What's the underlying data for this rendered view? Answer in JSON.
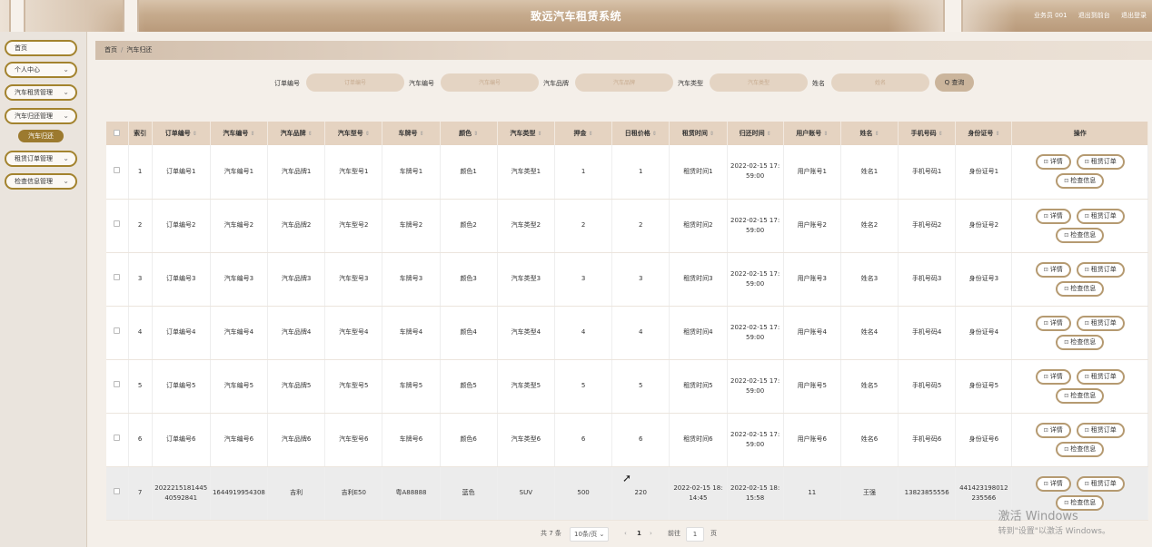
{
  "header": {
    "title": "致远汽车租赁系统",
    "user": "业务员 001",
    "back_label": "退出到前台",
    "logout_label": "退出登录"
  },
  "sidebar": {
    "items": [
      {
        "label": "首页",
        "has_arrow": false
      },
      {
        "label": "个人中心",
        "has_arrow": true
      },
      {
        "label": "汽车租赁管理",
        "has_arrow": true
      },
      {
        "label": "汽车归还管理",
        "has_arrow": true
      },
      {
        "label": "租赁订单管理",
        "has_arrow": true
      },
      {
        "label": "检查信息管理",
        "has_arrow": true
      }
    ],
    "active_sub": "汽车归还",
    "arrow_glyph": "⌄"
  },
  "breadcrumb": {
    "home": "首页",
    "sep": "/",
    "current": "汽车归还"
  },
  "search": {
    "fields": [
      {
        "label": "订单编号",
        "placeholder": "订单编号"
      },
      {
        "label": "汽车编号",
        "placeholder": "汽车编号"
      },
      {
        "label": "汽车品牌",
        "placeholder": "汽车品牌"
      },
      {
        "label": "汽车类型",
        "placeholder": "汽车类型"
      },
      {
        "label": "姓名",
        "placeholder": "姓名"
      }
    ],
    "button_icon": "Q",
    "button_label": "查询"
  },
  "table": {
    "sort_glyph": "⇕",
    "columns": [
      "索引",
      "订单编号",
      "汽车编号",
      "汽车品牌",
      "汽车型号",
      "车牌号",
      "颜色",
      "汽车类型",
      "押金",
      "日租价格",
      "租赁时间",
      "归还时间",
      "用户账号",
      "姓名",
      "手机号码",
      "身份证号",
      "操作"
    ],
    "rows": [
      {
        "idx": "1",
        "order": "订单编号1",
        "car": "汽车编号1",
        "brand": "汽车品牌1",
        "model": "汽车型号1",
        "plate": "车牌号1",
        "color": "颜色1",
        "type": "汽车类型1",
        "deposit": "1",
        "price": "1",
        "rent_time": "租赁时间1",
        "return_time": "2022-02-15 17:59:00",
        "account": "用户账号1",
        "name": "姓名1",
        "phone": "手机号码1",
        "id_no": "身份证号1"
      },
      {
        "idx": "2",
        "order": "订单编号2",
        "car": "汽车编号2",
        "brand": "汽车品牌2",
        "model": "汽车型号2",
        "plate": "车牌号2",
        "color": "颜色2",
        "type": "汽车类型2",
        "deposit": "2",
        "price": "2",
        "rent_time": "租赁时间2",
        "return_time": "2022-02-15 17:59:00",
        "account": "用户账号2",
        "name": "姓名2",
        "phone": "手机号码2",
        "id_no": "身份证号2"
      },
      {
        "idx": "3",
        "order": "订单编号3",
        "car": "汽车编号3",
        "brand": "汽车品牌3",
        "model": "汽车型号3",
        "plate": "车牌号3",
        "color": "颜色3",
        "type": "汽车类型3",
        "deposit": "3",
        "price": "3",
        "rent_time": "租赁时间3",
        "return_time": "2022-02-15 17:59:00",
        "account": "用户账号3",
        "name": "姓名3",
        "phone": "手机号码3",
        "id_no": "身份证号3"
      },
      {
        "idx": "4",
        "order": "订单编号4",
        "car": "汽车编号4",
        "brand": "汽车品牌4",
        "model": "汽车型号4",
        "plate": "车牌号4",
        "color": "颜色4",
        "type": "汽车类型4",
        "deposit": "4",
        "price": "4",
        "rent_time": "租赁时间4",
        "return_time": "2022-02-15 17:59:00",
        "account": "用户账号4",
        "name": "姓名4",
        "phone": "手机号码4",
        "id_no": "身份证号4"
      },
      {
        "idx": "5",
        "order": "订单编号5",
        "car": "汽车编号5",
        "brand": "汽车品牌5",
        "model": "汽车型号5",
        "plate": "车牌号5",
        "color": "颜色5",
        "type": "汽车类型5",
        "deposit": "5",
        "price": "5",
        "rent_time": "租赁时间5",
        "return_time": "2022-02-15 17:59:00",
        "account": "用户账号5",
        "name": "姓名5",
        "phone": "手机号码5",
        "id_no": "身份证号5"
      },
      {
        "idx": "6",
        "order": "订单编号6",
        "car": "汽车编号6",
        "brand": "汽车品牌6",
        "model": "汽车型号6",
        "plate": "车牌号6",
        "color": "颜色6",
        "type": "汽车类型6",
        "deposit": "6",
        "price": "6",
        "rent_time": "租赁时间6",
        "return_time": "2022-02-15 17:59:00",
        "account": "用户账号6",
        "name": "姓名6",
        "phone": "手机号码6",
        "id_no": "身份证号6"
      },
      {
        "idx": "7",
        "order": "202221518144540592841",
        "car": "1644919954308",
        "brand": "吉利",
        "model": "吉利E50",
        "plate": "粤A88888",
        "color": "蓝色",
        "type": "SUV",
        "deposit": "500",
        "price": "220",
        "rent_time": "2022-02-15 18:14:45",
        "return_time": "2022-02-15 18:15:58",
        "account": "11",
        "name": "王强",
        "phone": "13823855556",
        "id_no": "441423198012235566"
      }
    ],
    "actions": {
      "detail": "详情",
      "order": "租赁订单",
      "check": "检查信息",
      "icon": "⊡"
    }
  },
  "pagination": {
    "total": "共 7 条",
    "page_size": "10条/页",
    "prev": "‹",
    "current": "1",
    "next": "›",
    "goto_label": "前往",
    "goto_value": "1",
    "page_unit": "页"
  },
  "watermark": {
    "line1": "激活 Windows",
    "line2": "转到\"设置\"以激活 Windows。"
  },
  "colors": {
    "accent": "#9c7a2f",
    "header_bg": "#c6ab8d",
    "table_head": "#e5d3c1"
  }
}
